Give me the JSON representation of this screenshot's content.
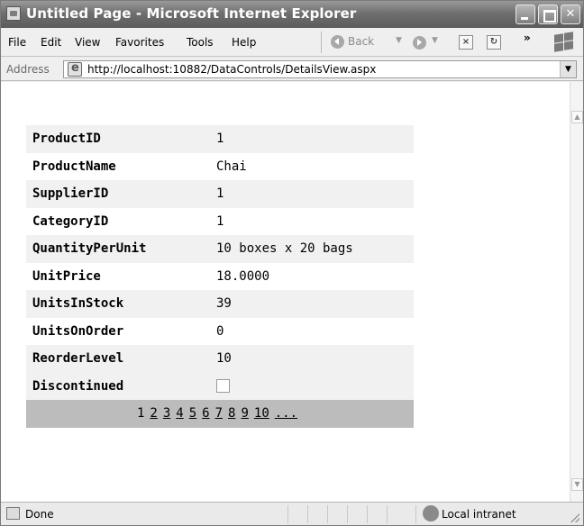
{
  "window": {
    "title": "Untitled Page - Microsoft Internet Explorer"
  },
  "menu": {
    "items": [
      "File",
      "Edit",
      "View",
      "Favorites",
      "Tools",
      "Help"
    ],
    "back_label": "Back",
    "overflow": "»"
  },
  "address": {
    "label": "Address",
    "url": "http://localhost:10882/DataControls/DetailsView.aspx"
  },
  "details": {
    "rows": [
      {
        "field": "ProductID",
        "value": "1"
      },
      {
        "field": "ProductName",
        "value": "Chai"
      },
      {
        "field": "SupplierID",
        "value": "1"
      },
      {
        "field": "CategoryID",
        "value": "1"
      },
      {
        "field": "QuantityPerUnit",
        "value": "10 boxes x 20 bags"
      },
      {
        "field": "UnitPrice",
        "value": "18.0000"
      },
      {
        "field": "UnitsInStock",
        "value": "39"
      },
      {
        "field": "UnitsOnOrder",
        "value": "0"
      },
      {
        "field": "ReorderLevel",
        "value": "10"
      }
    ],
    "discontinued": {
      "field": "Discontinued",
      "checked": false
    },
    "pager": {
      "current": "1",
      "pages": [
        "2",
        "3",
        "4",
        "5",
        "6",
        "7",
        "8",
        "9",
        "10",
        "..."
      ]
    }
  },
  "status": {
    "text": "Done",
    "zone": "Local intranet"
  },
  "colors": {
    "alt_row": "#f1f1f1",
    "pager_bg": "#bcbcbc",
    "title_bar": "#6f6f6f"
  }
}
